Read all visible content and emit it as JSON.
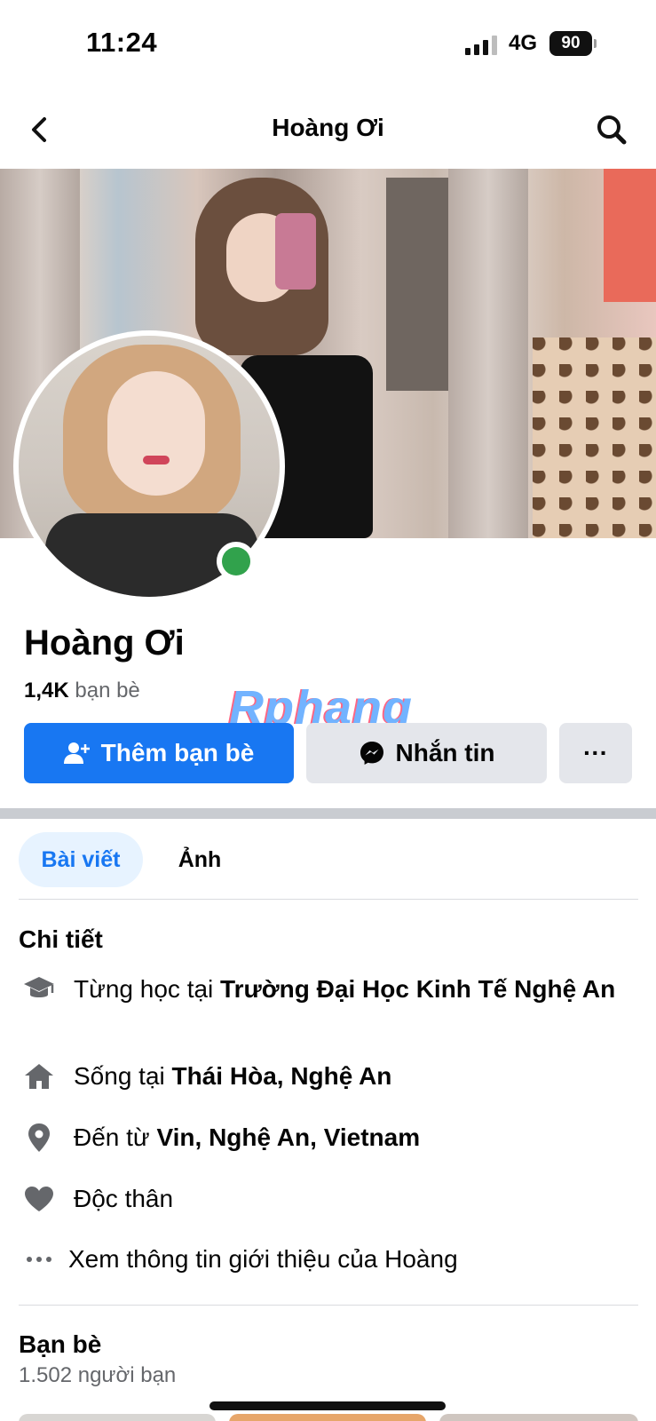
{
  "status_bar": {
    "time": "11:24",
    "network": "4G",
    "battery": "90"
  },
  "nav": {
    "title": "Hoàng Ơi",
    "back_icon": "chevron-left-icon",
    "search_icon": "search-icon"
  },
  "profile": {
    "name": "Hoàng Ơi",
    "friend_count": "1,4K",
    "friend_label": "bạn bè",
    "online": true,
    "online_color": "#31a24c"
  },
  "watermark": "Rphang",
  "actions": {
    "add_friend": "Thêm bạn bè",
    "message": "Nhắn tin",
    "more": "···",
    "primary_color": "#1877f2"
  },
  "tabs": [
    {
      "label": "Bài viết",
      "active": true
    },
    {
      "label": "Ảnh",
      "active": false
    }
  ],
  "details": {
    "title": "Chi tiết",
    "items": [
      {
        "icon": "graduation-cap-icon",
        "prefix": "Từng học tại ",
        "value": "Trường Đại Học Kinh Tế Nghệ An"
      },
      {
        "icon": "home-icon",
        "prefix": "Sống tại ",
        "value": "Thái Hòa, Nghệ An"
      },
      {
        "icon": "location-pin-icon",
        "prefix": "Đến từ ",
        "value": "Vin, Nghệ An, Vietnam"
      },
      {
        "icon": "heart-icon",
        "prefix": "Độc thân",
        "value": ""
      },
      {
        "icon": "more-dots-icon",
        "prefix": "Xem thông tin giới thiệu của Hoàng",
        "value": ""
      }
    ]
  },
  "friends": {
    "title": "Bạn bè",
    "subtitle": "1.502 người bạn"
  }
}
